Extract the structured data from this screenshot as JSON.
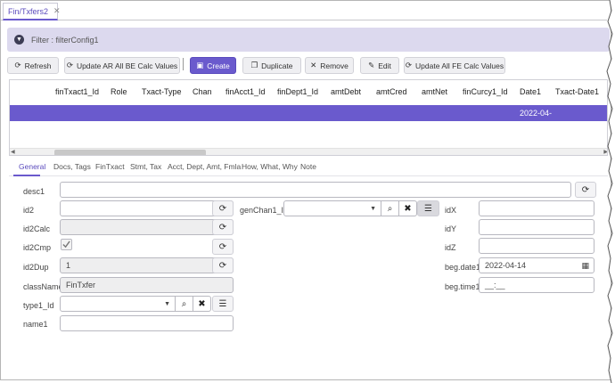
{
  "tabs": [
    {
      "label": "Fin/Txfers2",
      "close_icon": "close-icon"
    }
  ],
  "filter": {
    "label": "Filter : filterConfig1",
    "icon": "chevron-down-icon"
  },
  "toolbar": {
    "refresh": "Refresh",
    "update_ar": "Update AR All BE Calc Values",
    "create": "Create",
    "duplicate": "Duplicate",
    "remove": "Remove",
    "edit": "Edit",
    "update_fe": "Update All FE Calc Values"
  },
  "grid": {
    "columns": [
      "finTxact1_Id",
      "Role",
      "Txact-Type",
      "Chan",
      "finAcct1_Id",
      "finDept1_Id",
      "amtDebt",
      "amtCred",
      "amtNet",
      "finCurcy1_Id",
      "Date1",
      "Txact-Date1"
    ],
    "selected_row": {
      "Date1": "2022-04-"
    }
  },
  "subtabs": [
    "General",
    "Docs, Tags",
    "FinTxact",
    "Stmt, Tax",
    "Acct, Dept, Amt, Fmla",
    "How, What, Why",
    "Note"
  ],
  "form": {
    "desc1": {
      "label": "desc1",
      "value": ""
    },
    "id2": {
      "label": "id2",
      "value": ""
    },
    "id2Calc": {
      "label": "id2Calc",
      "value": ""
    },
    "id2Cmp": {
      "label": "id2Cmp",
      "checked": true
    },
    "id2Dup": {
      "label": "id2Dup",
      "value": "1"
    },
    "className": {
      "label": "className",
      "value": "FinTxfer"
    },
    "type1_Id": {
      "label": "type1_Id",
      "value": ""
    },
    "name1": {
      "label": "name1",
      "value": ""
    },
    "genChan1_Id": {
      "label": "genChan1_Id",
      "value": ""
    },
    "idX": {
      "label": "idX",
      "value": ""
    },
    "idY": {
      "label": "idY",
      "value": ""
    },
    "idZ": {
      "label": "idZ",
      "value": ""
    },
    "begDate1": {
      "label": "beg.date1",
      "value": "2022-04-14"
    },
    "begTime1": {
      "label": "beg.time1",
      "value": "__:__"
    }
  },
  "colors": {
    "accent": "#6a5acd",
    "filter_bg": "#dcd9ee"
  }
}
